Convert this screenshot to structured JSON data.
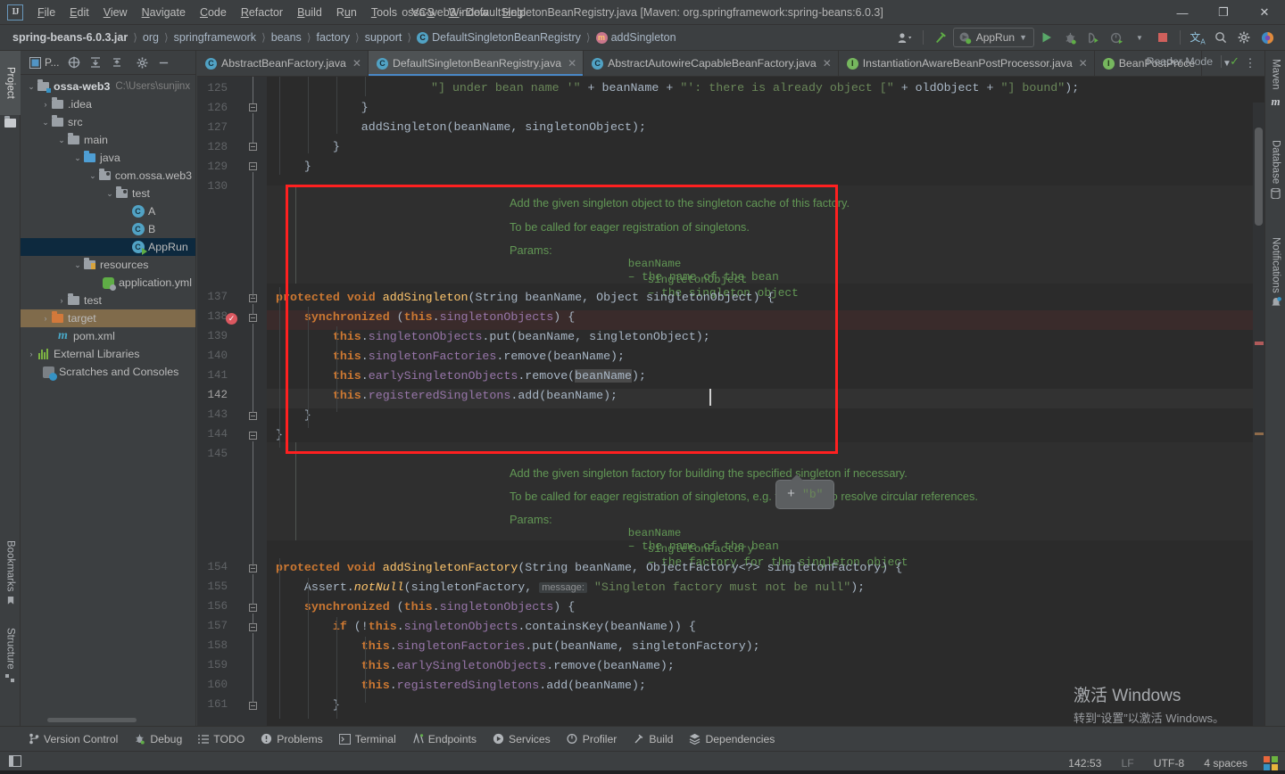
{
  "window": {
    "title": "ossa-web3 - DefaultSingletonBeanRegistry.java [Maven: org.springframework:spring-beans:6.0.3]",
    "logo": "IJ",
    "minimize": "—",
    "maximize": "❐",
    "close": "✕"
  },
  "menu": [
    {
      "label": "File",
      "name": "menu-file"
    },
    {
      "label": "Edit",
      "name": "menu-edit"
    },
    {
      "label": "View",
      "name": "menu-view"
    },
    {
      "label": "Navigate",
      "name": "menu-navigate"
    },
    {
      "label": "Code",
      "name": "menu-code"
    },
    {
      "label": "Refactor",
      "name": "menu-refactor"
    },
    {
      "label": "Build",
      "name": "menu-build"
    },
    {
      "label": "Run",
      "name": "menu-run"
    },
    {
      "label": "Tools",
      "name": "menu-tools"
    },
    {
      "label": "VCS",
      "name": "menu-vcs"
    },
    {
      "label": "Window",
      "name": "menu-window"
    },
    {
      "label": "Help",
      "name": "menu-help"
    }
  ],
  "breadcrumbs": [
    {
      "label": "spring-beans-6.0.3.jar",
      "icon": "",
      "root": true
    },
    {
      "label": "org",
      "icon": ""
    },
    {
      "label": "springframework",
      "icon": ""
    },
    {
      "label": "beans",
      "icon": ""
    },
    {
      "label": "factory",
      "icon": ""
    },
    {
      "label": "support",
      "icon": ""
    },
    {
      "label": "DefaultSingletonBeanRegistry",
      "icon": "class-icon"
    },
    {
      "label": "addSingleton",
      "icon": "method-icon"
    }
  ],
  "toolbar": {
    "run_config": "AppRun",
    "items": [
      {
        "name": "user-account-icon",
        "glyph": "♟"
      },
      {
        "name": "build-hammer-icon",
        "glyph": "⚒"
      },
      {
        "name": "run-button",
        "glyph": "▶"
      },
      {
        "name": "debug-button",
        "glyph": "🐞"
      },
      {
        "name": "run-with-coverage-button",
        "glyph": "◑"
      },
      {
        "name": "profiler-button",
        "glyph": "⏱"
      },
      {
        "name": "stop-button",
        "glyph": "■"
      },
      {
        "name": "translate-icon",
        "glyph": "文"
      },
      {
        "name": "search-icon",
        "glyph": "⚲"
      },
      {
        "name": "settings-gear-icon",
        "glyph": "⚙"
      },
      {
        "name": "ai-assistant-icon",
        "glyph": "◕"
      }
    ]
  },
  "left_strip": {
    "project": "Project",
    "bookmarks": "Bookmarks",
    "structure": "Structure"
  },
  "right_strip": {
    "maven": "Maven",
    "database": "Database",
    "notifications": "Notifications"
  },
  "project_panel": {
    "title": "P...",
    "tree": [
      {
        "indent": 0,
        "arrow": "⌄",
        "icon": "module-folder-icon",
        "label": "ossa-web3",
        "bold": true,
        "path": "C:\\Users\\sunjinx",
        "state": "normal"
      },
      {
        "indent": 1,
        "arrow": "›",
        "icon": "folder-icon",
        "label": ".idea",
        "state": "normal"
      },
      {
        "indent": 1,
        "arrow": "⌄",
        "icon": "folder-icon",
        "label": "src",
        "state": "normal"
      },
      {
        "indent": 2,
        "arrow": "⌄",
        "icon": "folder-icon",
        "label": "main",
        "state": "normal"
      },
      {
        "indent": 3,
        "arrow": "⌄",
        "icon": "source-folder-icon",
        "label": "java",
        "state": "normal"
      },
      {
        "indent": 4,
        "arrow": "⌄",
        "icon": "package-icon",
        "label": "com.ossa.web3",
        "state": "normal"
      },
      {
        "indent": 5,
        "arrow": "⌄",
        "icon": "package-icon",
        "label": "test",
        "state": "normal"
      },
      {
        "indent": 6,
        "arrow": "",
        "icon": "java-class-icon",
        "label": "A",
        "state": "normal"
      },
      {
        "indent": 6,
        "arrow": "",
        "icon": "java-class-icon",
        "label": "B",
        "state": "normal"
      },
      {
        "indent": 6,
        "arrow": "",
        "icon": "runnable-class-icon",
        "label": "AppRun",
        "state": "selected"
      },
      {
        "indent": 3,
        "arrow": "⌄",
        "icon": "resource-folder-icon",
        "label": "resources",
        "state": "normal"
      },
      {
        "indent": 4,
        "arrow": "",
        "icon": "yaml-file-icon",
        "label": "application.yml",
        "state": "normal"
      },
      {
        "indent": 2,
        "arrow": "›",
        "icon": "folder-icon",
        "label": "test",
        "state": "normal"
      },
      {
        "indent": 1,
        "arrow": "›",
        "icon": "target-folder-icon",
        "label": "target",
        "state": "highlighted"
      },
      {
        "indent": 1,
        "arrow": "",
        "icon": "maven-pom-icon",
        "label": "pom.xml",
        "state": "normal"
      },
      {
        "indent": 0,
        "arrow": "›",
        "icon": "external-libraries-icon",
        "label": "External Libraries",
        "state": "normal"
      },
      {
        "indent": 0,
        "arrow": "",
        "icon": "scratches-icon",
        "label": "Scratches and Consoles",
        "state": "normal"
      }
    ]
  },
  "editor_tabs": [
    {
      "label": "AbstractBeanFactory.java",
      "icon": "class",
      "active": false
    },
    {
      "label": "DefaultSingletonBeanRegistry.java",
      "icon": "class",
      "active": true
    },
    {
      "label": "AbstractAutowireCapableBeanFactory.java",
      "icon": "class",
      "active": false
    },
    {
      "label": "InstantiationAwareBeanPostProcessor.java",
      "icon": "interface",
      "active": false
    },
    {
      "label": "BeanPostProce",
      "icon": "interface",
      "active": false
    }
  ],
  "reader_mode": {
    "label": "Reader Mode",
    "check": "✓"
  },
  "code": {
    "line_numbers": [
      "125",
      "126",
      "127",
      "128",
      "129",
      "130",
      "137",
      "138",
      "139",
      "140",
      "141",
      "142",
      "143",
      "144",
      "145",
      "154",
      "155",
      "156",
      "157",
      "158",
      "159",
      "160",
      "161"
    ],
    "top_partial": {
      "segments": [
        {
          "t": "\"] under bean name '\"",
          "c": "str"
        },
        {
          "t": " + ",
          "c": "plain"
        },
        {
          "t": "beanName",
          "c": "plain"
        },
        {
          "t": " + ",
          "c": "plain"
        },
        {
          "t": "\"': there is already object [\"",
          "c": "str"
        },
        {
          "t": " + ",
          "c": "plain"
        },
        {
          "t": "oldObject",
          "c": "plain"
        },
        {
          "t": " + ",
          "c": "plain"
        },
        {
          "t": "\"] bound\"",
          "c": "str"
        },
        {
          "t": ");",
          "c": "plain"
        }
      ]
    },
    "doc_block_1": [
      {
        "text": "Add the given singleton object to the singleton cache of this factory.",
        "mono": false
      },
      {
        "text": "To be called for eager registration of singletons.",
        "mono": false
      }
    ],
    "doc_block_1_params": {
      "label": "Params:",
      "rows": [
        {
          "name": "beanName",
          "desc": "– the name of the bean"
        },
        {
          "name": "singletonObject",
          "desc": "– the singleton object"
        }
      ]
    },
    "doc_block_2": [
      {
        "text": "Add the given singleton factory for building the specified singleton if necessary.",
        "mono": false
      },
      {
        "text": "To be called for eager registration of singletons, e.g. to be able to resolve circular references.",
        "mono": false
      }
    ],
    "doc_block_2_params": {
      "label": "Params:",
      "rows": [
        {
          "name": "beanName",
          "desc": "– the name of the bean"
        },
        {
          "name": "singletonFactory",
          "desc": "– the factory for the singleton object"
        }
      ]
    },
    "assert_hint": "message:"
  },
  "popup": {
    "plus": "+",
    "value": "\"b\""
  },
  "bottom_tools": [
    {
      "label": "Version Control",
      "icon": "branch-icon"
    },
    {
      "label": "Debug",
      "icon": "bug-icon"
    },
    {
      "label": "TODO",
      "icon": "todo-icon"
    },
    {
      "label": "Problems",
      "icon": "problems-icon"
    },
    {
      "label": "Terminal",
      "icon": "terminal-icon"
    },
    {
      "label": "Endpoints",
      "icon": "endpoints-icon"
    },
    {
      "label": "Services",
      "icon": "services-icon"
    },
    {
      "label": "Profiler",
      "icon": "profiler-icon"
    },
    {
      "label": "Build",
      "icon": "build-hammer-icon"
    },
    {
      "label": "Dependencies",
      "icon": "dependencies-icon"
    }
  ],
  "status_bar": {
    "caret_position": "142:53",
    "line_separator": "LF",
    "encoding": "UTF-8",
    "indent": "4 spaces"
  },
  "watermark": {
    "line1": "激活 Windows",
    "line2": "转到“设置”以激活 Windows。"
  },
  "colors": {
    "accent_blue": "#4a88c7",
    "red_box": "#ff2020",
    "selection": "#0d293e",
    "editor_bg": "#2b2b2b",
    "panel_bg": "#3c3f41"
  }
}
